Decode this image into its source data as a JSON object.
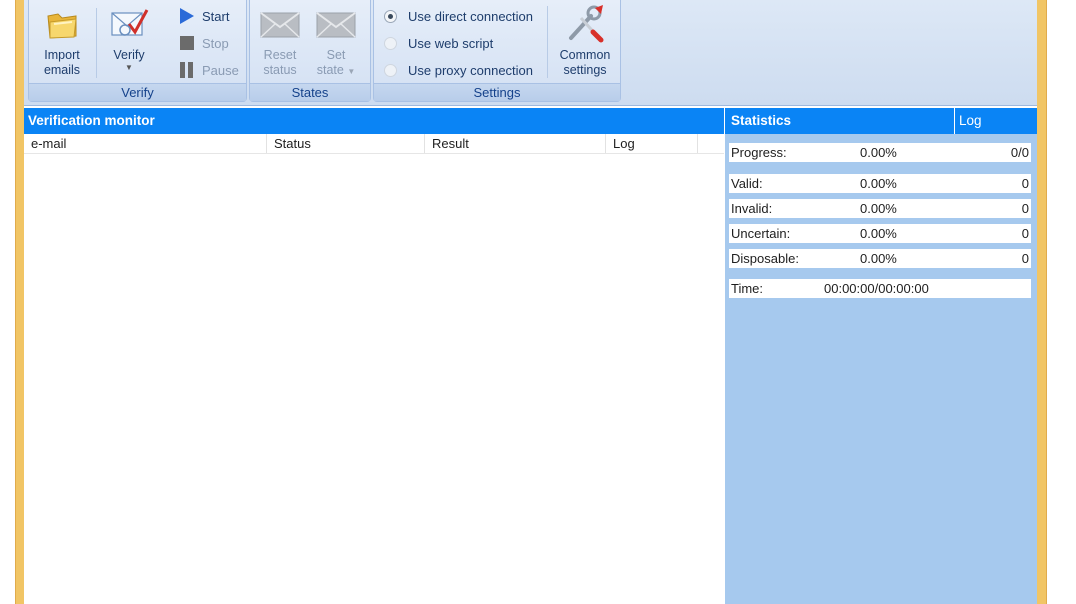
{
  "ribbon": {
    "groups": {
      "verify": {
        "label": "Verify",
        "import_line1": "Import",
        "import_line2": "emails",
        "verify_label": "Verify",
        "start": "Start",
        "stop": "Stop",
        "pause": "Pause"
      },
      "states": {
        "label": "States",
        "reset_line1": "Reset",
        "reset_line2": "status",
        "set_line1": "Set",
        "set_line2": "state"
      },
      "settings": {
        "label": "Settings",
        "radio_direct": "Use direct connection",
        "radio_web": "Use web script",
        "radio_proxy": "Use proxy connection",
        "selected": "Use direct connection",
        "common_line1": "Common",
        "common_line2": "settings"
      }
    }
  },
  "monitor": {
    "title": "Verification monitor",
    "columns": [
      "e-mail",
      "Status",
      "Result",
      "Log"
    ]
  },
  "stats": {
    "tab_statistics": "Statistics",
    "tab_log": "Log",
    "progress": {
      "label": "Progress:",
      "percent": "0.00%",
      "count": "0/0"
    },
    "valid": {
      "label": "Valid:",
      "percent": "0.00%",
      "count": "0"
    },
    "invalid": {
      "label": "Invalid:",
      "percent": "0.00%",
      "count": "0"
    },
    "uncertain": {
      "label": "Uncertain:",
      "percent": "0.00%",
      "count": "0"
    },
    "disposable": {
      "label": "Disposable:",
      "percent": "0.00%",
      "count": "0"
    },
    "time": {
      "label": "Time:",
      "value": "00:00:00/00:00:00"
    }
  },
  "colors": {
    "accent_header": "#0a84f5",
    "stats_background": "#a6c9ee",
    "window_frame": "#f1c565"
  }
}
